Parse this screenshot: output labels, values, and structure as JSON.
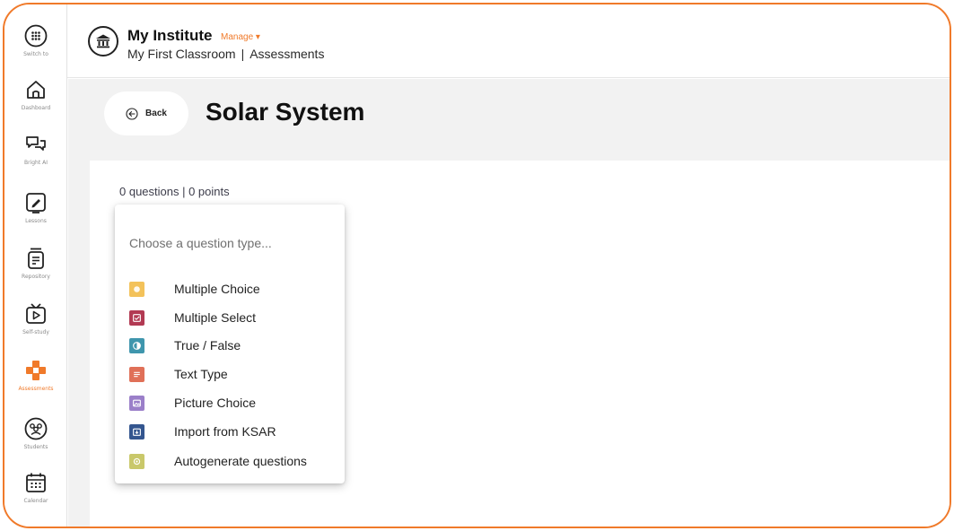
{
  "sidebar": {
    "items": [
      {
        "label": "Switch to",
        "icon": "apps-grid-icon"
      },
      {
        "label": "Dashboard",
        "icon": "home-icon"
      },
      {
        "label": "Bright AI",
        "icon": "chat-bubbles-icon"
      },
      {
        "label": "Lessons",
        "icon": "edit-board-icon"
      },
      {
        "label": "Repository",
        "icon": "document-stack-icon"
      },
      {
        "label": "Self-study",
        "icon": "play-tv-icon"
      },
      {
        "label": "Assessments",
        "icon": "puzzle-icon"
      },
      {
        "label": "Students",
        "icon": "students-group-icon"
      },
      {
        "label": "Calendar",
        "icon": "calendar-icon"
      }
    ],
    "active_item": "Assessments"
  },
  "header": {
    "institute_name": "My Institute",
    "manage_label": "Manage ▾",
    "breadcrumb": {
      "classroom": "My First Classroom",
      "separator": "|",
      "section": "Assessments"
    }
  },
  "page": {
    "back_label": "Back",
    "title": "Solar System",
    "counts": "0 questions | 0 points"
  },
  "dropdown": {
    "hint": "Choose a question type...",
    "items": [
      {
        "label": "Multiple Choice",
        "icon": "multiple-choice-icon",
        "color": "#f3c25a"
      },
      {
        "label": "Multiple Select",
        "icon": "multiple-select-icon",
        "color": "#b23a53"
      },
      {
        "label": "True / False",
        "icon": "true-false-icon",
        "color": "#3f96ad"
      },
      {
        "label": "Text Type",
        "icon": "text-type-icon",
        "color": "#e07058"
      },
      {
        "label": "Picture Choice",
        "icon": "picture-choice-icon",
        "color": "#9b7fc9"
      },
      {
        "label": "Import from KSAR",
        "icon": "import-icon",
        "color": "#34568f"
      },
      {
        "label": "Autogenerate questions",
        "icon": "autogenerate-icon",
        "color": "#c9c86a"
      }
    ]
  },
  "colors": {
    "accent": "#f07a2a",
    "title_band": "#f2f2f2"
  }
}
